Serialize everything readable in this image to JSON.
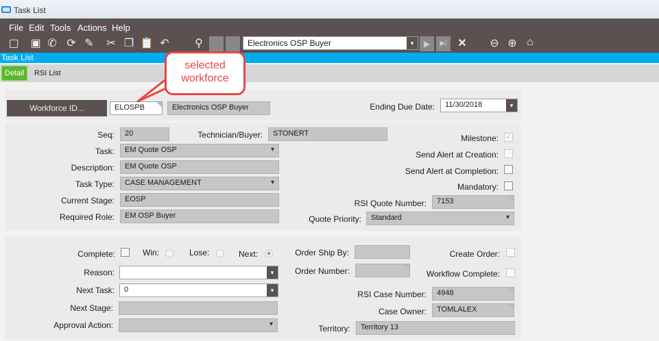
{
  "window": {
    "title": "Task List"
  },
  "menu": [
    "File",
    "Edit",
    "Tools",
    "Actions",
    "Help"
  ],
  "toolbar": {
    "record_selector": "Electronics OSP Buyer"
  },
  "header_bar": "Task List",
  "tabs": [
    {
      "label": "Detail",
      "active": true
    },
    {
      "label": "RSI List",
      "active": false
    }
  ],
  "callout": "selected workforce",
  "workforce": {
    "button": "Workforce ID...",
    "id": "ELOSPB",
    "name": "Electronics OSP Buyer",
    "ending_due_date_label": "Ending Due Date:",
    "ending_due_date": "11/30/2018"
  },
  "task": {
    "seq_label": "Seq:",
    "seq": "20",
    "technician_label": "Technician/Buyer:",
    "technician": "STONERT",
    "task_label": "Task:",
    "task": "EM Quote OSP",
    "description_label": "Description:",
    "description": "EM Quote OSP",
    "task_type_label": "Task Type:",
    "task_type": "CASE MANAGEMENT",
    "current_stage_label": "Current Stage:",
    "current_stage": "EOSP",
    "required_role_label": "Required Role:",
    "required_role": "EM OSP Buyer",
    "milestone_label": "Milestone:",
    "milestone": true,
    "alert_creation_label": "Send Alert at Creation:",
    "alert_creation": false,
    "alert_completion_label": "Send Alert at Completion:",
    "alert_completion": false,
    "mandatory_label": "Mandatory:",
    "mandatory": false,
    "rsi_quote_label": "RSI Quote Number:",
    "rsi_quote": "7153",
    "quote_priority_label": "Quote Priority:",
    "quote_priority": "Standard"
  },
  "completion": {
    "complete_label": "Complete:",
    "win_label": "Win:",
    "lose_label": "Lose:",
    "next_label": "Next:",
    "selected": "Next",
    "reason_label": "Reason:",
    "reason": "",
    "next_task_label": "Next Task:",
    "next_task": "0",
    "next_stage_label": "Next Stage:",
    "next_stage": "",
    "approval_label": "Approval Action:",
    "approval": "",
    "ship_by_label": "Order Ship By:",
    "order_number_label": "Order Number:",
    "create_order_label": "Create Order:",
    "workflow_complete_label": "Workflow Complete:",
    "rsi_case_label": "RSI Case Number:",
    "rsi_case": "4948",
    "case_owner_label": "Case Owner:",
    "case_owner": "TOMLALEX",
    "territory_label": "Territory:",
    "territory": "Territory 13"
  }
}
